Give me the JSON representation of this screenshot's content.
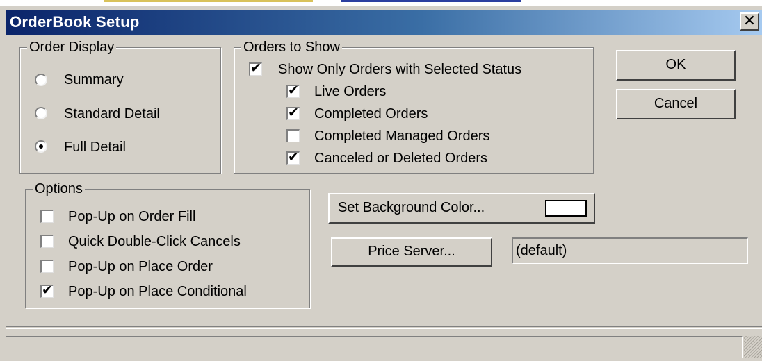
{
  "window": {
    "title": "OrderBook Setup",
    "close_glyph": "✕"
  },
  "order_display": {
    "legend": "Order Display",
    "options": [
      {
        "label": "Summary",
        "selected": false
      },
      {
        "label": "Standard Detail",
        "selected": false
      },
      {
        "label": "Full Detail",
        "selected": true
      }
    ]
  },
  "orders_to_show": {
    "legend": "Orders to Show",
    "show_only_selected_status": {
      "label": "Show Only Orders with Selected Status",
      "checked": true
    },
    "statuses": [
      {
        "label": "Live Orders",
        "checked": true
      },
      {
        "label": "Completed Orders",
        "checked": true
      },
      {
        "label": "Completed Managed Orders",
        "checked": false
      },
      {
        "label": "Canceled or Deleted Orders",
        "checked": true
      }
    ]
  },
  "options": {
    "legend": "Options",
    "items": [
      {
        "label": "Pop-Up on Order Fill",
        "checked": false
      },
      {
        "label": "Quick Double-Click Cancels",
        "checked": false
      },
      {
        "label": "Pop-Up on Place Order",
        "checked": false
      },
      {
        "label": "Pop-Up on Place Conditional",
        "checked": true
      }
    ]
  },
  "buttons": {
    "ok": "OK",
    "cancel": "Cancel",
    "set_background_color": "Set Background Color...",
    "price_server": "Price Server..."
  },
  "background_color": "#ffffff",
  "price_server_value": "(default)",
  "check_glyph": "✔"
}
